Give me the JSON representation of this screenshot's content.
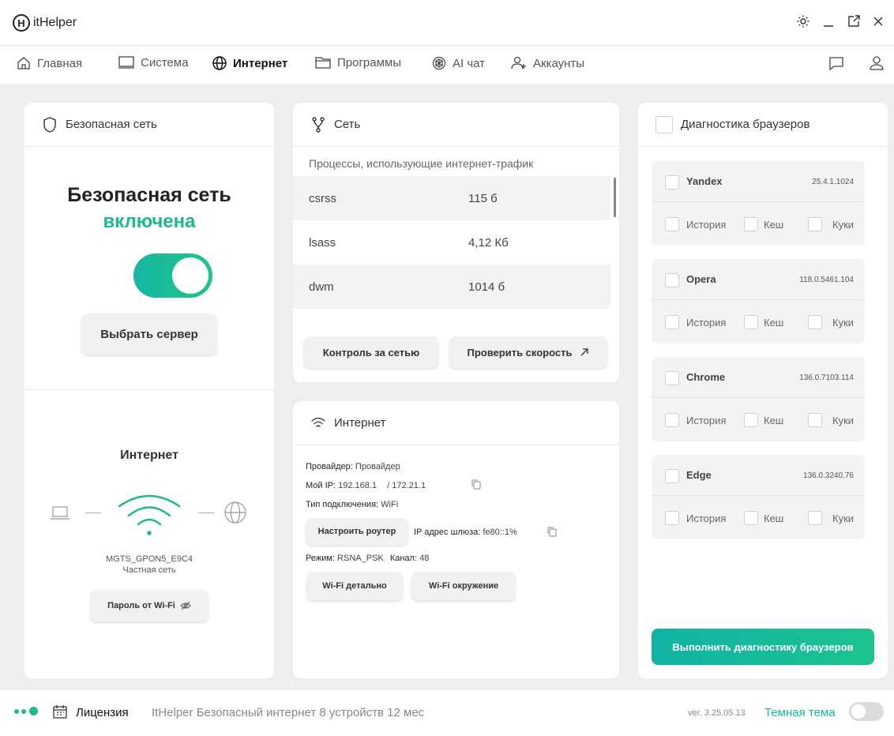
{
  "app": {
    "logo_letter": "H",
    "title": "itHelper"
  },
  "nav": {
    "items": [
      {
        "label": "Главная",
        "icon": "home-icon"
      },
      {
        "label": "Система",
        "icon": "monitor-icon"
      },
      {
        "label": "Интернет",
        "icon": "globe-icon",
        "active": true
      },
      {
        "label": "Программы",
        "icon": "folder-icon"
      },
      {
        "label": "AI чат",
        "icon": "ai-icon"
      },
      {
        "label": "Аккаунты",
        "icon": "add-user-icon"
      }
    ]
  },
  "secure": {
    "header": "Безопасная сеть",
    "title": "Безопасная сеть",
    "status": "включена",
    "toggle_on": true,
    "server_button": "Выбрать сервер",
    "internet_title": "Интернет",
    "network_name": "MGTS_GPON5_E9C4",
    "network_type": "Частная сеть",
    "wifi_password_button": "Пароль от Wi-Fi"
  },
  "network": {
    "header": "Сеть",
    "subtitle": "Процессы, использующие интернет-трафик",
    "processes": [
      {
        "name": "csrss",
        "traffic": "115 б"
      },
      {
        "name": "lsass",
        "traffic": "4,12 Кб"
      },
      {
        "name": "dwm",
        "traffic": "1014 б"
      }
    ],
    "control_button": "Контроль за сетью",
    "speed_button": "Проверить скорость"
  },
  "internet": {
    "header": "Интернет",
    "provider_label": "Провайдер:",
    "provider_value": "Провайдер",
    "ip_label": "Мой IP:",
    "ip_value_1": "192.168.1",
    "ip_value_2": "/ 172.21.1",
    "conn_type_label": "Тип подключения:",
    "conn_type_value": "WiFi",
    "router_button": "Настроить роутер",
    "gateway_label": "IP адрес шлюза:",
    "gateway_value": "fe80::1%",
    "mode_label": "Режим:",
    "mode_value": "RSNA_PSK",
    "channel_label": "Канал:",
    "channel_value": "48",
    "wifi_detail_button": "Wi-Fi детально",
    "wifi_env_button": "Wi-Fi окружение"
  },
  "browsers": {
    "header": "Диагностика браузеров",
    "history_label": "История",
    "cache_label": "Кеш",
    "cookies_label": "Куки",
    "items": [
      {
        "name": "Yandex",
        "version": "25.4.1.1024"
      },
      {
        "name": "Opera",
        "version": "118.0.5461.104"
      },
      {
        "name": "Chrome",
        "version": "136.0.7103.114"
      },
      {
        "name": "Edge",
        "version": "136.0.3240.76"
      }
    ],
    "run_button": "Выполнить диагностику браузеров"
  },
  "footer": {
    "license_label": "Лицензия",
    "license_text": "ItHelper Безопасный интернет 8 устройств 12 мес",
    "version": "ver. 3.25.05.13",
    "theme_label": "Темная тема",
    "dark_theme_on": false
  },
  "colors": {
    "accent": "#1db98a",
    "accent_teal": "#12b3a6",
    "background": "#eceef0"
  }
}
